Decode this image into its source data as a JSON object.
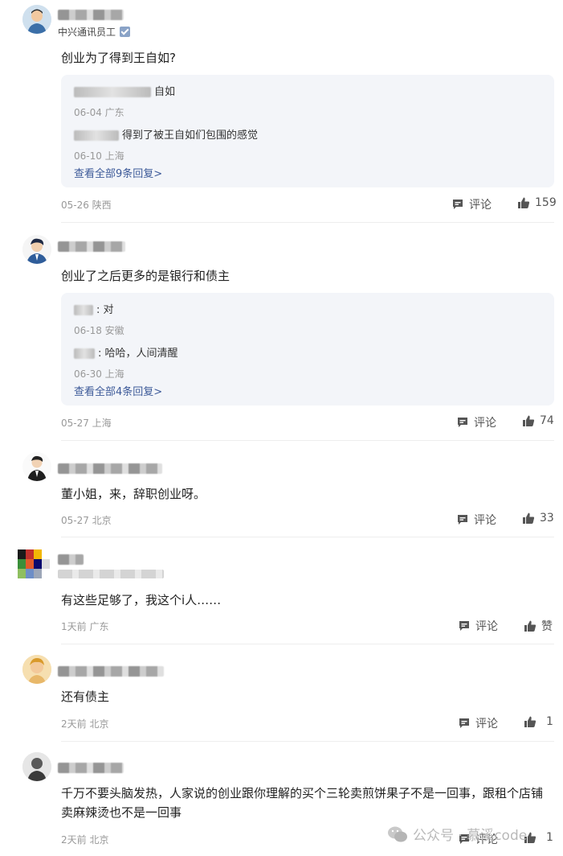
{
  "comments": [
    {
      "role": "中兴通讯员工",
      "text": "创业为了得到王自如?",
      "replies": [
        {
          "text": "自如",
          "meta": "06-04 广东"
        },
        {
          "text": "得到了被王自如们包围的感觉",
          "meta": "06-10 上海"
        }
      ],
      "more": "查看全部9条回复>",
      "meta": "05-26 陕西",
      "comment_label": "评论",
      "likes": "159"
    },
    {
      "text": "创业了之后更多的是银行和债主",
      "replies": [
        {
          "text": ": 对",
          "meta": "06-18 安徽"
        },
        {
          "text": ": 哈哈，人间清醒",
          "meta": "06-30 上海"
        }
      ],
      "more": "查看全部4条回复>",
      "meta": "05-27 上海",
      "comment_label": "评论",
      "likes": "74"
    },
    {
      "text": "董小姐，来，辞职创业呀。",
      "meta": "05-27 北京",
      "comment_label": "评论",
      "likes": "33"
    },
    {
      "text": "有这些足够了，我这个i人……",
      "meta": "1天前 广东",
      "comment_label": "评论",
      "likes": "赞"
    },
    {
      "text": "还有债主",
      "meta": "2天前 北京",
      "comment_label": "评论",
      "likes": "1"
    },
    {
      "text": "千万不要头脑发热，人家说的创业跟你理解的买个三轮卖煎饼果子不是一回事，跟租个店铺卖麻辣烫也不是一回事",
      "meta": "2天前 北京",
      "comment_label": "评论",
      "likes": "1"
    }
  ],
  "watermark": "公众号 · 慕溪code",
  "colors": {
    "link": "#3d5a99",
    "meta": "#999999",
    "reply_bg": "#f3f5f9",
    "divider": "#eeeeee"
  },
  "icons": {
    "comment": "comment-bubble-icon",
    "like": "thumbs-up-icon",
    "verified": "verified-badge-icon",
    "wechat": "wechat-icon"
  }
}
